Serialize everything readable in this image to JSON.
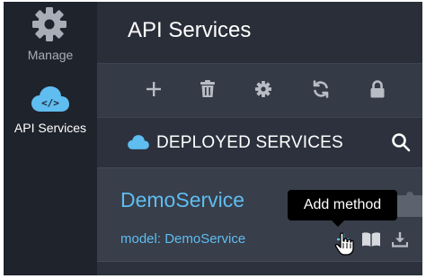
{
  "rail": {
    "items": [
      {
        "label": "Manage",
        "icon": "gear-icon",
        "active": false
      },
      {
        "label": "API Services",
        "icon": "cloud-code-icon",
        "active": true
      }
    ]
  },
  "header": {
    "title": "API Services"
  },
  "toolbar": {
    "actions": [
      {
        "icon": "plus-icon",
        "tooltip": "Add"
      },
      {
        "icon": "trash-icon",
        "tooltip": "Delete"
      },
      {
        "icon": "gear-icon",
        "tooltip": "Settings"
      },
      {
        "icon": "refresh-icon",
        "tooltip": "Refresh"
      },
      {
        "icon": "lock-icon",
        "tooltip": "Lock"
      }
    ]
  },
  "section": {
    "title": "DEPLOYED SERVICES",
    "icon": "cloud-icon",
    "search_icon": "search-icon"
  },
  "service": {
    "name": "DemoService",
    "model": "model: DemoService",
    "actions": [
      {
        "icon": "plus-icon",
        "name": "add-method"
      },
      {
        "icon": "book-icon",
        "name": "docs"
      },
      {
        "icon": "download-icon",
        "name": "download"
      }
    ]
  },
  "tooltip": {
    "text": "Add method"
  },
  "colors": {
    "rail_bg": "#1f232c",
    "panel_bg": "#2c313d",
    "toolbar_bg": "#343a46",
    "row_bg": "#383e4a",
    "accent": "#5fbdf0",
    "icon_gray": "#b8bcc4"
  }
}
